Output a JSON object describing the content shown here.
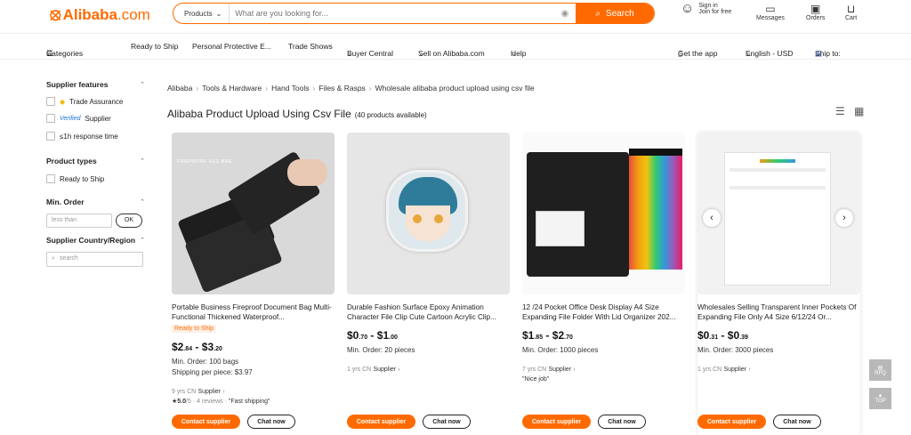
{
  "header": {
    "logo": "Alibaba",
    "logo_suffix": ".com",
    "search": {
      "category": "Products",
      "placeholder": "What are you looking for...",
      "button": "Search"
    },
    "signin": "Sign in",
    "join": "Join for free",
    "messages": "Messages",
    "orders": "Orders",
    "cart": "Cart"
  },
  "nav": {
    "categories": "Categories",
    "items": [
      "Ready to Ship",
      "Personal Protective E...",
      "Trade Shows",
      "Buyer Central",
      "Sell on Alibaba.com",
      "Help"
    ],
    "get_app": "Get the app",
    "language": "English - USD",
    "ship_to": "Ship to:"
  },
  "sidebar": {
    "supplier_features": "Supplier features",
    "trade_assurance": "Trade Assurance",
    "verified": "Verified",
    "verified_supplier": "Supplier",
    "response": "≤1h response time",
    "product_types": "Product types",
    "ready_to_ship": "Ready to Ship",
    "min_order": "Min. Order",
    "less_than": "less than",
    "ok": "OK",
    "country": "Supplier Country/Region",
    "search_placeholder": "search"
  },
  "breadcrumb": [
    "Alibaba",
    "Tools & Hardware",
    "Hand Tools",
    "Files & Rasps",
    "Wholesale alibaba product upload using csv file"
  ],
  "page_title": "Alibaba Product Upload Using Csv File",
  "product_count": "(40 products available)",
  "products": [
    {
      "title": "Portable Business Fireproof Document Bag Multi-Functional Thickened Waterproof...",
      "img_text": "FIREPROOF FILE BAG",
      "ready": "Ready to Ship",
      "price_a": "$2",
      "price_a_c": ".84",
      "price_sep": " - $",
      "price_b": "3",
      "price_b_c": ".20",
      "min_order": "Min. Order: 100 bags",
      "shipping": "Shipping per piece: $3.97",
      "supplier_yrs": "9 yrs CN",
      "supplier": "Supplier",
      "rating": "5.0",
      "rating_max": "/5",
      "reviews": "· 4 reviews ·",
      "review_quote": "\"Fast shipping\"",
      "contact": "Contact supplier",
      "chat": "Chat now"
    },
    {
      "title": "Durable Fashion Surface Epoxy Animation Character File Clip Cute Cartoon Acrylic Clip...",
      "price_a": "$0",
      "price_a_c": ".70",
      "price_sep": " - $",
      "price_b": "1",
      "price_b_c": ".00",
      "min_order": "Min. Order: 20 pieces",
      "supplier_yrs": "1 yrs CN",
      "supplier": "Supplier",
      "contact": "Contact supplier",
      "chat": "Chat now"
    },
    {
      "title": "12 /24 Pocket Office Desk Display A4 Size Expanding File Folder With Lid Organizer 202...",
      "price_a": "$1",
      "price_a_c": ".85",
      "price_sep": " - $",
      "price_b": "2",
      "price_b_c": ".70",
      "min_order": "Min. Order: 1000 pieces",
      "supplier_yrs": "7 yrs CN",
      "supplier": "Supplier",
      "review_quote": "\"Nice job\"",
      "contact": "Contact supplier",
      "chat": "Chat now"
    },
    {
      "title": "Wholesales Selling Transparent Inner Pockets Of Expanding File Only A4 Size 6/12/24 Or...",
      "price_a": "$0",
      "price_a_c": ".31",
      "price_sep": " - $",
      "price_b": "0",
      "price_b_c": ".39",
      "min_order": "Min. Order: 3000 pieces",
      "supplier_yrs": "1 yrs CN",
      "supplier": "Supplier",
      "contact": "Contact supplier",
      "chat": "Chat now"
    }
  ],
  "float": {
    "rfq": "RFQ",
    "top": "TOP"
  },
  "colors": {
    "accent": "#ff6a00"
  }
}
